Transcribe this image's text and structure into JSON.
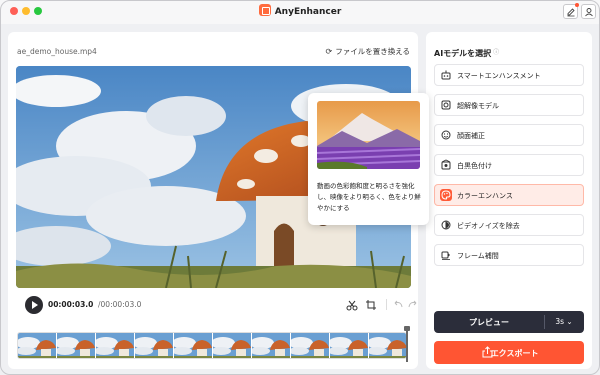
{
  "app": {
    "title": "AnyEnhancer"
  },
  "editor": {
    "filename": "ae_demo_house.mp4",
    "replace_label": "ファイルを置き換える",
    "time_current": "00:00:03.0",
    "time_total": "/00:00:03.0",
    "tooltip_text": "動画の色彩飽和度と明るさを強化し、映像をより明るく、色をより鮮やかにする"
  },
  "sidebar": {
    "title": "AIモデルを選択",
    "info_icon": "info-icon",
    "items": [
      {
        "label": "スマートエンハンスメント",
        "icon": "robot-icon"
      },
      {
        "label": "超解像モデル",
        "icon": "resolution-icon"
      },
      {
        "label": "顔面補正",
        "icon": "face-icon"
      },
      {
        "label": "白黒色付け",
        "icon": "colorize-icon"
      },
      {
        "label": "カラーエンハンス",
        "icon": "palette-icon",
        "active": true
      },
      {
        "label": "ビデオノイズを除去",
        "icon": "denoise-icon"
      },
      {
        "label": "フレーム補間",
        "icon": "frame-icon"
      }
    ],
    "preview_label": "プレビュー",
    "preview_duration": "3s",
    "export_label": "エクスポート"
  },
  "colors": {
    "accent": "#ff5533",
    "dark_button": "#2b2d3a",
    "active_bg": "#ffece7"
  }
}
